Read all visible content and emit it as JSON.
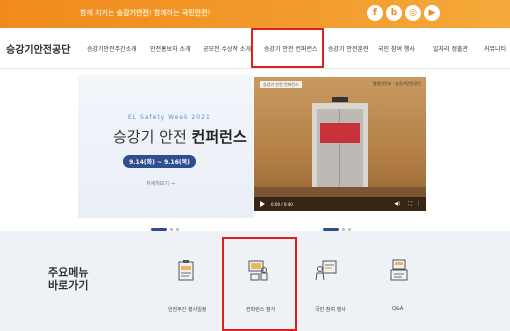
{
  "topbar": {
    "slogan_prefix": "함께 지키는 ",
    "slogan_b1": "승강기안전",
    "slogan_mid": "! 함께하는 ",
    "slogan_b2": "국민안전",
    "slogan_end": "!",
    "sns": [
      {
        "icon": "facebook-icon",
        "glyph": "f"
      },
      {
        "icon": "blog-icon",
        "glyph": "b"
      },
      {
        "icon": "instagram-icon",
        "glyph": "◎"
      },
      {
        "icon": "youtube-icon",
        "glyph": "▶"
      }
    ]
  },
  "logo": "승강기안전공단",
  "nav": [
    "승강기안전주간소개",
    "안전홍보자 소개",
    "공모전 수상작 소개",
    "승강기 안전 컨퍼런스",
    "승강기 안전훈련",
    "국민 참여 행사",
    "일자리 정출관",
    "커뮤니티"
  ],
  "hero": {
    "subtitle": "EL Safety Week 2021",
    "title_light": "승강기 안전 ",
    "title_bold": "컨퍼런스",
    "date": "9.14(화) ~ 9.16(목)",
    "more": "자세히보기 →"
  },
  "video": {
    "tag": "승강기 안전 컨퍼런스",
    "brand": "행정안전부 · 승강기안전공단",
    "time": "0:00 / 0:40"
  },
  "quick_menu": {
    "title_line1": "주요메뉴",
    "title_line2": "바로가기",
    "items": [
      {
        "label": "안전주간 행사일정",
        "icon": "schedule-icon"
      },
      {
        "label": "컨퍼런스 참가",
        "icon": "conference-icon"
      },
      {
        "label": "국민 참여 행사",
        "icon": "participation-icon"
      },
      {
        "label": "Q&A",
        "icon": "qa-icon"
      }
    ]
  },
  "colors": {
    "topbar": "#f08a1c",
    "accent_navy": "#2f4e8f",
    "highlight_box": "#e02020",
    "quick_bg": "#eef1f6"
  }
}
